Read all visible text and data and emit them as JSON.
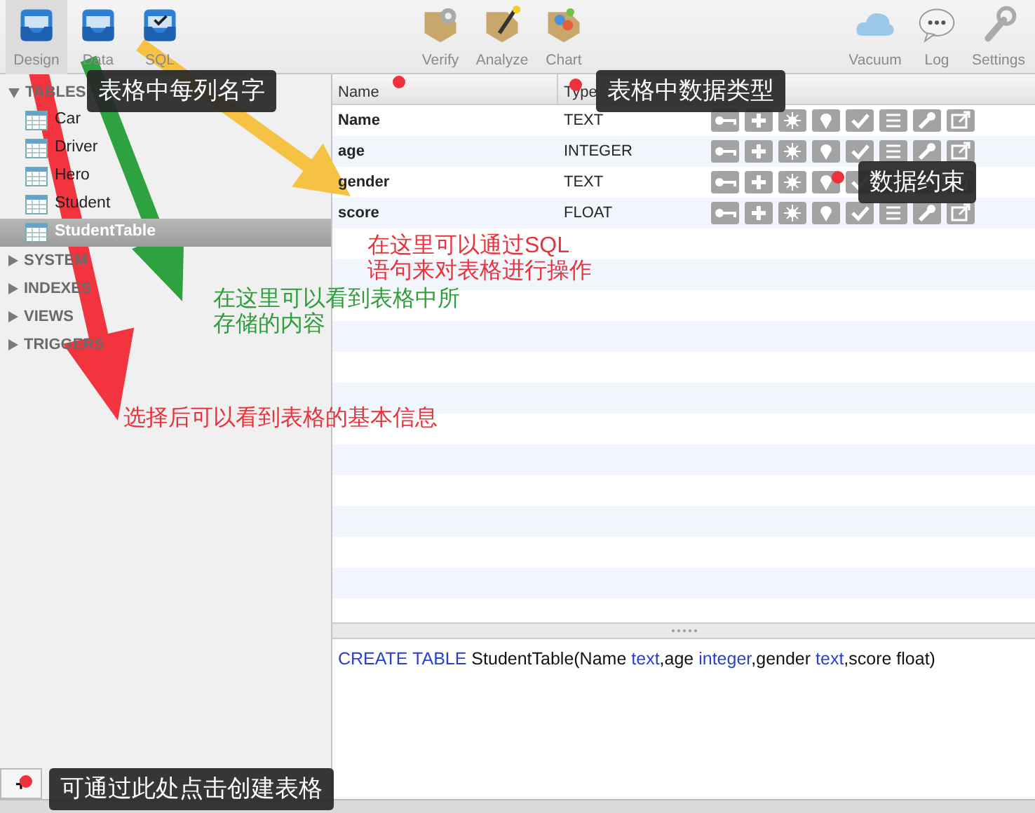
{
  "toolbar": {
    "left_tools": [
      {
        "label": "Design",
        "selected": true
      },
      {
        "label": "Data",
        "selected": false
      },
      {
        "label": "SQL",
        "selected": false
      }
    ],
    "center_tools": [
      {
        "label": "Verify"
      },
      {
        "label": "Analyze"
      },
      {
        "label": "Chart"
      }
    ],
    "right_tools": [
      {
        "label": "Vacuum"
      },
      {
        "label": "Log"
      },
      {
        "label": "Settings"
      }
    ]
  },
  "sidebar": {
    "sections": [
      {
        "label": "TABLES",
        "expanded": true,
        "children": [
          {
            "label": "Car",
            "selected": false
          },
          {
            "label": "Driver",
            "selected": false
          },
          {
            "label": "Hero",
            "selected": false
          },
          {
            "label": "Student",
            "selected": false
          },
          {
            "label": "StudentTable",
            "selected": true
          }
        ]
      },
      {
        "label": "SYSTEM",
        "expanded": false
      },
      {
        "label": "INDEXES",
        "expanded": false
      },
      {
        "label": "VIEWS",
        "expanded": false
      },
      {
        "label": "TRIGGERS",
        "expanded": false
      }
    ],
    "add_button": "+"
  },
  "table": {
    "columns": [
      "Name",
      "Type"
    ],
    "rows": [
      {
        "name": "Name",
        "type": "TEXT"
      },
      {
        "name": "age",
        "type": "INTEGER"
      },
      {
        "name": "gender",
        "type": "TEXT"
      },
      {
        "name": "score",
        "type": "FLOAT"
      }
    ]
  },
  "sql": {
    "segments": [
      {
        "text": "CREATE TABLE",
        "kind": "keyword"
      },
      {
        "text": " StudentTable(Name ",
        "kind": "plain"
      },
      {
        "text": "text",
        "kind": "keyword"
      },
      {
        "text": ",age ",
        "kind": "plain"
      },
      {
        "text": "integer",
        "kind": "keyword"
      },
      {
        "text": ",gender ",
        "kind": "plain"
      },
      {
        "text": "text",
        "kind": "keyword"
      },
      {
        "text": ",score float)",
        "kind": "plain"
      }
    ]
  },
  "annotations": {
    "callouts": [
      {
        "text": "表格中每列名字"
      },
      {
        "text": "表格中数据类型"
      },
      {
        "text": "数据约束"
      },
      {
        "text": "可通过此处点击创建表格"
      }
    ],
    "notes": [
      {
        "lines": [
          "在这里可以通过SQL",
          "语句来对表格进行操作"
        ],
        "color": "#e8323c"
      },
      {
        "lines": [
          "在这里可以看到表格中所",
          "存储的内容"
        ],
        "color": "#2e9e3c"
      },
      {
        "lines": [
          "选择后可以看到表格的基本信息"
        ],
        "color": "#e8323c"
      }
    ]
  }
}
